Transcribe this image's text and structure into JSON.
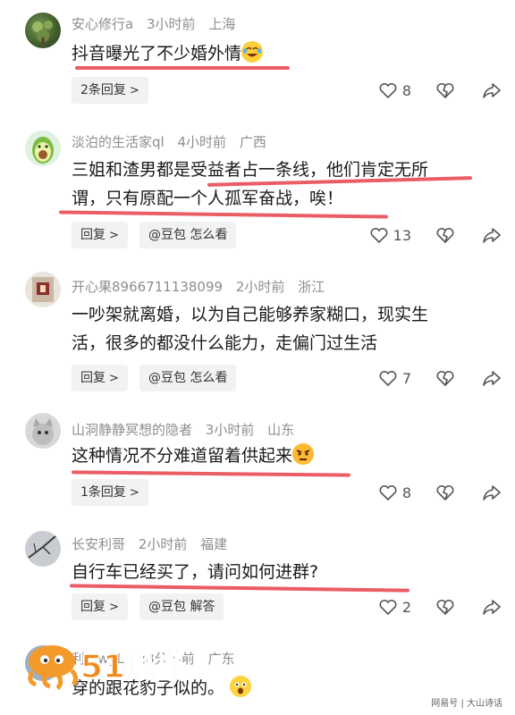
{
  "comments": [
    {
      "user": "安心修行a",
      "time": "3小时前",
      "location": "上海",
      "text": "抖音曝光了不少婚外情",
      "pill_left": "2条回复",
      "likes": "8"
    },
    {
      "user": "淡泊的生活家ql",
      "time": "4小时前",
      "location": "广西",
      "text_line1": "三姐和渣男都是受益者占一条线，他们肯定无所",
      "text_line2": "谓，只有原配一个人孤军奋战，唉！",
      "pill_left": "回复",
      "pill_right": "@豆包 怎么看",
      "likes": "13"
    },
    {
      "user": "开心果8966711138099",
      "time": "2小时前",
      "location": "浙江",
      "text_line1": "一吵架就离婚，以为自己能够养家糊口，现实生",
      "text_line2": "活，很多的都没什么能力，走偏门过生活",
      "pill_left": "回复",
      "pill_right": "@豆包 怎么看",
      "likes": "7"
    },
    {
      "user": "山洞静静冥想的隐者",
      "time": "3小时前",
      "location": "山东",
      "text": "这种情况不分难道留着供起来",
      "pill_left": "1条回复",
      "likes": "8"
    },
    {
      "user": "长安利哥",
      "time": "2小时前",
      "location": "福建",
      "text": "自行车已经买了，请问如何进群?",
      "pill_left": "回复",
      "pill_right": "@豆包 解答",
      "likes": "2"
    },
    {
      "user": "利...wyL",
      "time": "28分钟前",
      "location": "广东",
      "text": "穿的跟花豹子似的。"
    }
  ],
  "watermark": {
    "text": "51瓜条"
  },
  "corner_mark": "网易号 | 大山诗话",
  "colors": {
    "underline": "#e8414a",
    "meta": "#8e8e8e",
    "pill_bg": "#f2f2f2"
  }
}
